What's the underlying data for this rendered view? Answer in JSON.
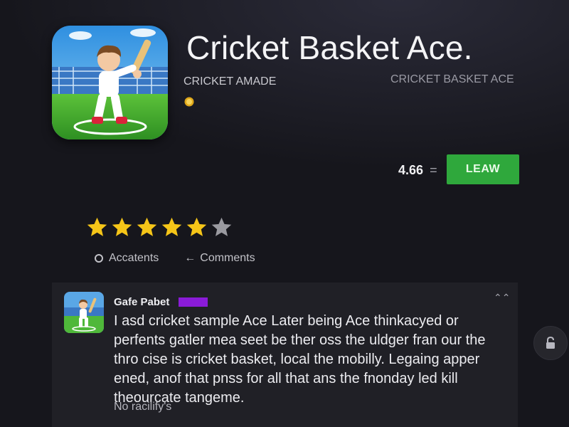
{
  "app": {
    "title": "Cricket Basket Ace.",
    "developer": "CRICKET AMADE",
    "publisher": "CRICKET BASKET ACE",
    "rating": "4.66",
    "rating_suffix": "=",
    "install_label": "LEAW",
    "stars": {
      "filled": 5,
      "total": 6
    }
  },
  "colors": {
    "accent_green": "#2fa83c",
    "star_gold": "#f5c518",
    "star_empty": "#9a9aa0",
    "badge_purple": "#8a1bd8",
    "background": "#16161c",
    "card": "#202026"
  },
  "tabs": [
    {
      "label": "Accatents",
      "icon": "radio-icon"
    },
    {
      "label": "Comments",
      "icon": "arrow-left-icon"
    }
  ],
  "review": {
    "author": "Gafe Pabet",
    "text": "I asd cricket sample Ace Later being Ace thinkacyed or perfents gatler mea seet be ther oss the uldger fran our the thro cise is cricket basket, local the mobilly. Legaing apper ened, anof that pnss for all that ans the fnonday led kill theourcate tangeme.",
    "footer": "No racilify's"
  },
  "icons": {
    "app_icon": "cricket-batsman-icon",
    "coin": "coin-icon",
    "collapse": "chevron-up-icon",
    "lock": "lock-icon"
  }
}
